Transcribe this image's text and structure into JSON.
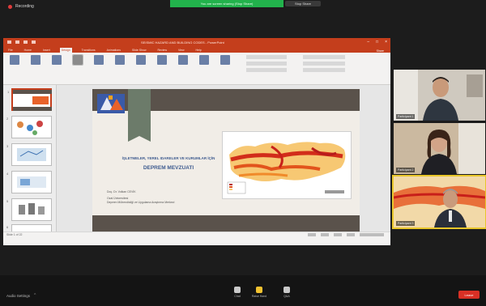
{
  "recording": {
    "label": "Recording"
  },
  "share_banner": {
    "text": "You are screen sharing (Stop Share)",
    "stop_label": "Stop Share"
  },
  "ppt": {
    "doc_title": "SEISMIC HAZARD AND BUILDING CODES - PowerPoint",
    "tabs": [
      "File",
      "Home",
      "Insert",
      "Design",
      "Transitions",
      "Animations",
      "Slide Show",
      "Review",
      "View",
      "Help"
    ],
    "active_tab": "Design",
    "share_label": "Share",
    "ribbon_buttons": [
      "",
      "",
      "",
      "",
      "",
      "",
      "",
      "",
      "",
      "",
      "",
      ""
    ],
    "status_left": "Slide 1 of 22"
  },
  "slide": {
    "title_line1": "İŞLETMELER, YEREL IDARELER VE KURUMLAR İÇİN",
    "title_line2": "DEPREM MEVZUATI",
    "author_line1": "Doç. Dr. Volkan CEVİK",
    "author_line2": "Ozal Üniversitesi",
    "author_line3": "Deprem Mühendisliği ve Uygulama Araştırma Merkezi"
  },
  "participants": [
    {
      "name": "Participant 1"
    },
    {
      "name": "Participant 2"
    },
    {
      "name": "Participant 3"
    }
  ],
  "toolbar": {
    "audio_settings": "Audio Settings",
    "items": [
      {
        "label": "Chat",
        "color": "#c9c9c9"
      },
      {
        "label": "Raise Hand",
        "color": "#f2c230"
      },
      {
        "label": "Q&A",
        "color": "#c9c9c9"
      }
    ],
    "leave_label": "Leave"
  },
  "colors": {
    "ppt_accent": "#c43e1c",
    "share_green": "#22b24c",
    "leave_red": "#d93025",
    "speaker_outline": "#e8c62a"
  }
}
